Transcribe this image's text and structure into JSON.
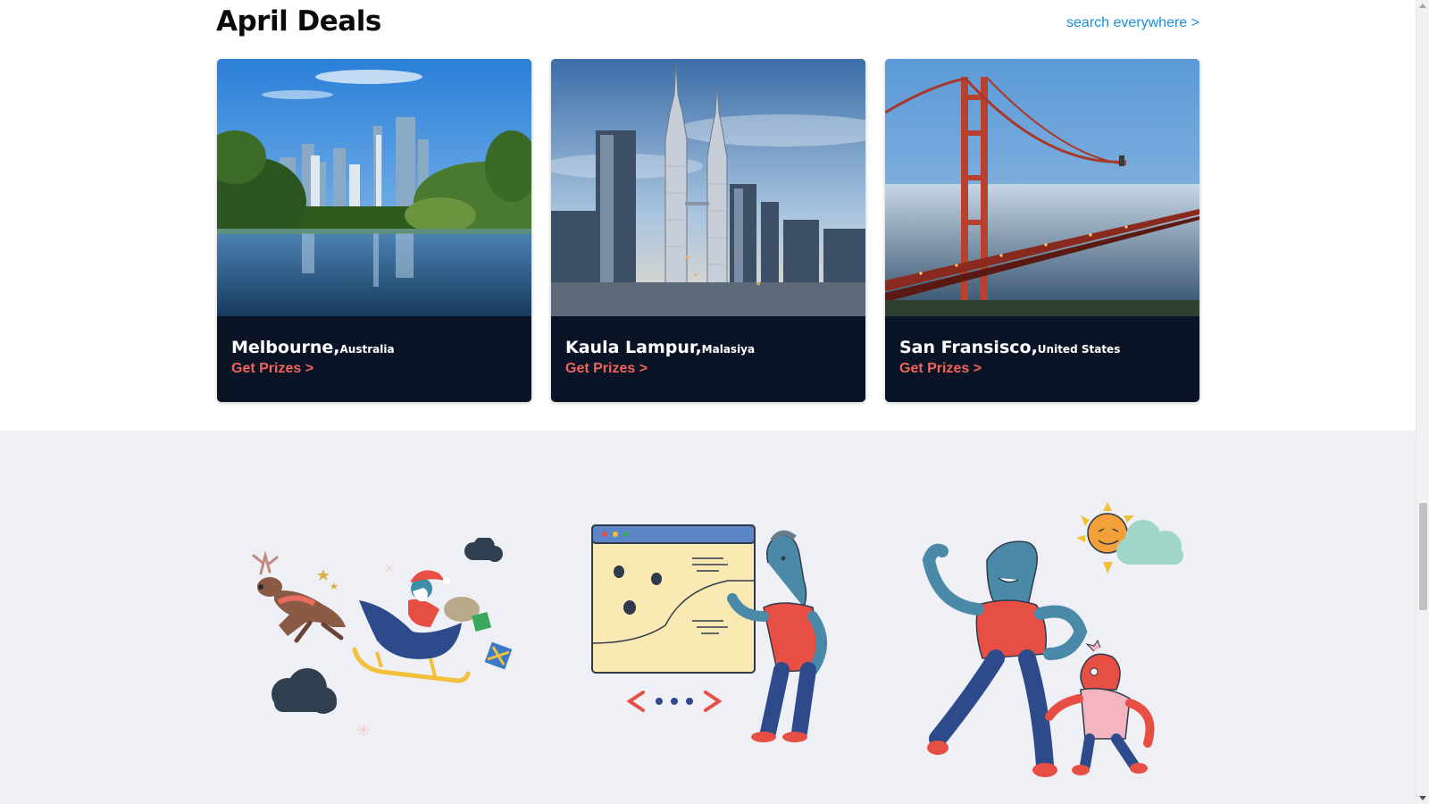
{
  "section": {
    "title": "April Deals",
    "search_link": "search everywhere >"
  },
  "cards": [
    {
      "city": "Melbourne,",
      "country": "Australia",
      "cta": "Get Prizes >",
      "image": "melbourne-skyline-lake"
    },
    {
      "city": "Kaula Lampur,",
      "country": "Malasiya",
      "cta": "Get Prizes >",
      "image": "petronas-towers"
    },
    {
      "city": "San Fransisco,",
      "country": "United States",
      "cta": "Get Prizes >",
      "image": "golden-gate-bridge-fog"
    }
  ],
  "illustrations": [
    {
      "icon": "santa-sleigh-reindeer-illustration"
    },
    {
      "icon": "browser-bugs-character-illustration"
    },
    {
      "icon": "dancing-characters-sun-illustration"
    }
  ],
  "colors": {
    "card_bg": "#0b1426",
    "cta": "#f0645a",
    "link": "#1a8ee0",
    "bottom_bg": "#eff0f6"
  }
}
